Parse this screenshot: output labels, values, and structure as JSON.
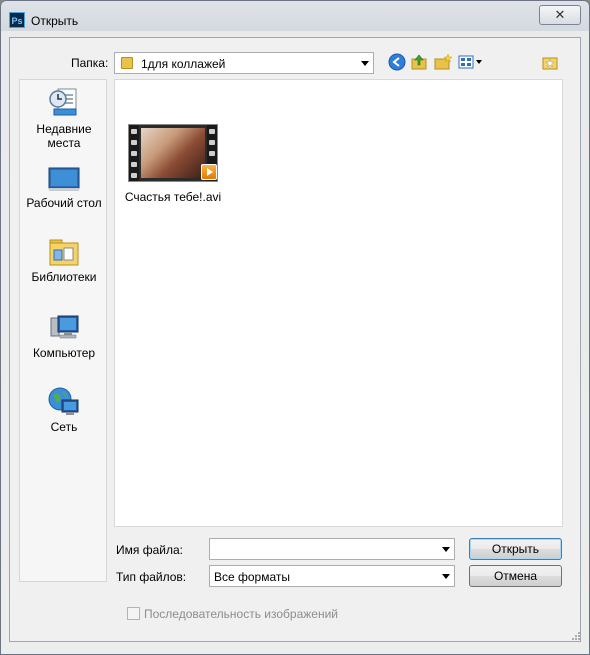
{
  "window": {
    "title": "Открыть",
    "app_icon_text": "Ps",
    "close_symbol": "✕"
  },
  "toolbar": {
    "folder_label": "Папка:",
    "current_folder": "1для коллажей",
    "icons": [
      "back-icon",
      "up-folder-icon",
      "new-folder-icon",
      "view-menu-icon",
      "preview-icon"
    ]
  },
  "sidebar": {
    "items": [
      {
        "label": "Недавние места",
        "icon": "recent-places-icon"
      },
      {
        "label": "Рабочий стол",
        "icon": "desktop-icon"
      },
      {
        "label": "Библиотеки",
        "icon": "libraries-icon"
      },
      {
        "label": "Компьютер",
        "icon": "computer-icon"
      },
      {
        "label": "Сеть",
        "icon": "network-icon"
      }
    ]
  },
  "files": [
    {
      "name": "Счастья тебе!.avi",
      "icon": "video-file-icon"
    }
  ],
  "form": {
    "filename_label": "Имя файла:",
    "filename_value": "",
    "filetype_label": "Тип файлов:",
    "filetype_value": "Все форматы",
    "open_button": "Открыть",
    "cancel_button": "Отмена",
    "sequence_label": "Последовательность изображений",
    "sequence_checked": false
  },
  "colors": {
    "accent": "#3c7fb1",
    "folder": "#e8c24a"
  }
}
